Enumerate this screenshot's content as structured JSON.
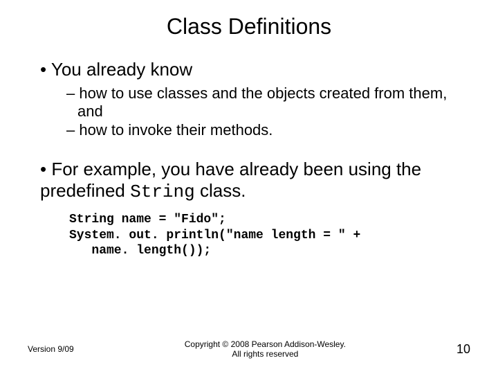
{
  "title": "Class Definitions",
  "bullets": {
    "b1": "You already know",
    "b1_sub1": "how to use classes and the objects created from them, and",
    "b1_sub2": "how to invoke their methods.",
    "b2_pre": "For example, you have already been using the predefined ",
    "b2_code": "String",
    "b2_post": " class."
  },
  "code": "String name = \"Fido\";\nSystem. out. println(\"name length = \" +\n   name. length());",
  "footer": {
    "version": "Version 9/09",
    "copyright_line1": "Copyright © 2008 Pearson Addison-Wesley.",
    "copyright_line2": "All rights reserved",
    "page": "10"
  }
}
